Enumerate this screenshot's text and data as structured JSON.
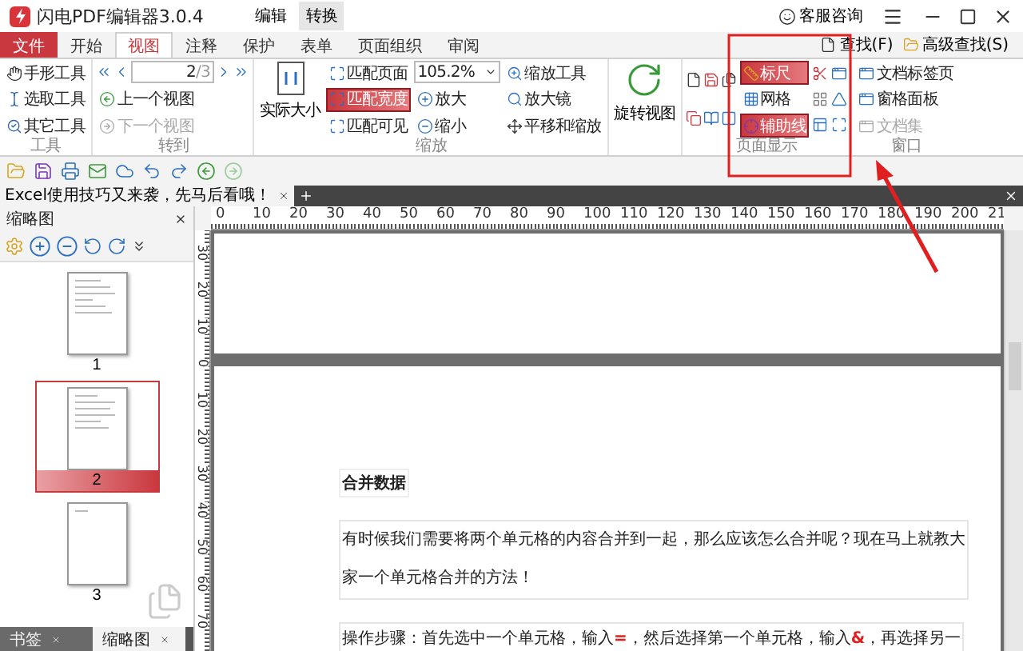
{
  "window": {
    "title": "闪电PDF编辑器3.0.4",
    "title_tabs": [
      {
        "label": "编辑",
        "selected": false
      },
      {
        "label": "转换",
        "selected": true
      }
    ],
    "support": "客服咨询"
  },
  "ribbon_tabs": [
    {
      "label": "文件",
      "kind": "file",
      "selected": false
    },
    {
      "label": "开始",
      "kind": "tab",
      "selected": false
    },
    {
      "label": "视图",
      "kind": "tab",
      "selected": true
    },
    {
      "label": "注释",
      "kind": "tab",
      "selected": false
    },
    {
      "label": "保护",
      "kind": "tab",
      "selected": false
    },
    {
      "label": "表单",
      "kind": "tab",
      "selected": false
    },
    {
      "label": "页面组织",
      "kind": "tab",
      "selected": false
    },
    {
      "label": "审阅",
      "kind": "tab",
      "selected": false
    }
  ],
  "search_links": [
    "查找(F)",
    "高级查找(S)"
  ],
  "tools_group": {
    "label": "工具",
    "items": [
      "手形工具",
      "选取工具",
      "其它工具"
    ]
  },
  "goto_group": {
    "label": "转到",
    "page": "2",
    "total": "/3",
    "prev_view": {
      "label": "上一个视图",
      "disabled": false
    },
    "next_view": {
      "label": "下一个视图",
      "disabled": true
    }
  },
  "zoom_group": {
    "label": "缩放",
    "actual_size": "实际大小",
    "fit": [
      {
        "label": "匹配页面",
        "selected": false
      },
      {
        "label": "匹配宽度",
        "selected": true
      },
      {
        "label": "匹配可见",
        "selected": false
      }
    ],
    "zoom_value": "105.2%",
    "zoom_in": "放大",
    "zoom_out": "缩小",
    "tools": [
      "缩放工具",
      "放大镜",
      "平移和缩放"
    ]
  },
  "rotate": "旋转视图",
  "display_group": {
    "label": "页面显示",
    "toggles": [
      {
        "label": "标尺",
        "on": true
      },
      {
        "label": "网格",
        "on": false
      },
      {
        "label": "辅助线",
        "on": true
      }
    ]
  },
  "window_group": {
    "label": "窗口",
    "items": [
      {
        "label": "文档标签页",
        "disabled": false
      },
      {
        "label": "窗格面板",
        "disabled": false
      },
      {
        "label": "文档集",
        "disabled": true
      }
    ]
  },
  "document_tab": "Excel使用技巧又来袭，先马后看哦！",
  "thumbnail_panel": {
    "title": "缩略图",
    "pages": [
      {
        "label": "1",
        "selected": false
      },
      {
        "label": "2",
        "selected": true
      },
      {
        "label": "3",
        "selected": false
      }
    ],
    "bottom_tabs": [
      {
        "label": "书签",
        "selected": false
      },
      {
        "label": "缩略图",
        "selected": true
      }
    ]
  },
  "ruler": {
    "x_labels": [
      "0",
      "10",
      "20",
      "30",
      "40",
      "50",
      "60",
      "70",
      "80",
      "90",
      "100",
      "110",
      "120",
      "130",
      "140",
      "150",
      "160",
      "170",
      "180",
      "190",
      "200",
      "21"
    ],
    "y_labels": [
      "30",
      "20",
      "10",
      "0",
      "10",
      "20",
      "30",
      "40",
      "50",
      "60",
      "70"
    ]
  },
  "document": {
    "heading": "合并数据",
    "paragraph_lines": [
      "有时候我们需要将两个单元格的内容合并到一起，那么应该怎么合并呢？现在马上就教大",
      "家一个单元格合并的方法！"
    ],
    "step": "操作步骤：首先选中一个单元格，输入**=**，然后选择第一个单元格，输入**&**，再选择另一"
  }
}
